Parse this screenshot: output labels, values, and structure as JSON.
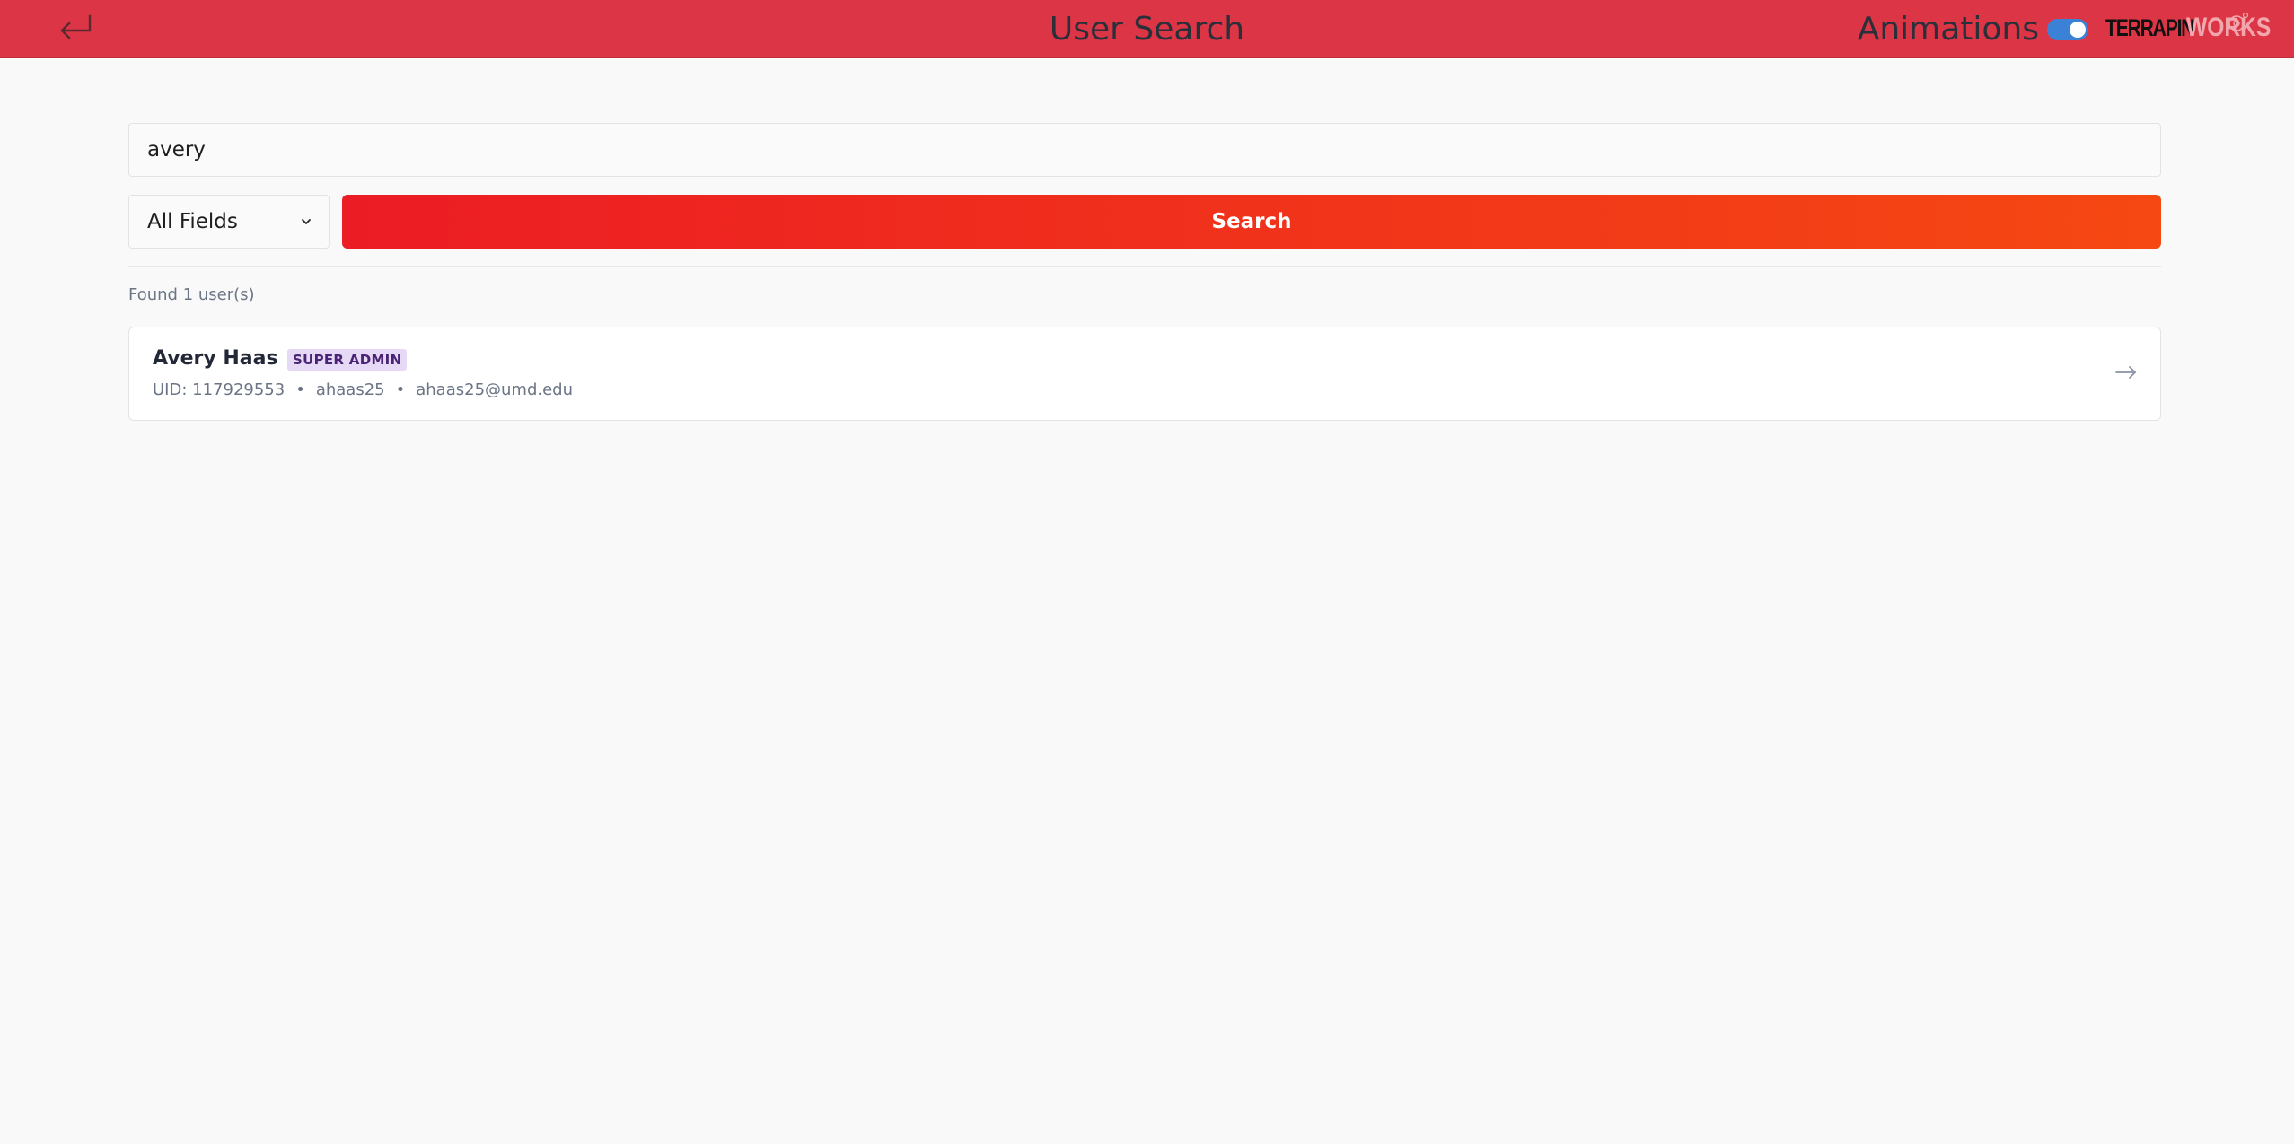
{
  "header": {
    "title": "User Search",
    "animations_label": "Animations",
    "animations_enabled": true,
    "logo_text": "TERRAPIN WORKS",
    "logo_colors": {
      "terrapin": "#111111",
      "works": "#f1a7ad"
    },
    "background_color": "#dc3545",
    "back_icon": "return-arrow-icon"
  },
  "search": {
    "query": "avery",
    "field_filter": "All Fields",
    "button_label": "Search",
    "button_gradient": [
      "#ec1c24",
      "#f54812"
    ]
  },
  "results": {
    "count_text": "Found 1 user(s)",
    "users": [
      {
        "name": "Avery Haas",
        "role": "SUPER ADMIN",
        "uid": "UID: 117929553",
        "username": "ahaas25",
        "email": "ahaas25@umd.edu"
      }
    ]
  }
}
